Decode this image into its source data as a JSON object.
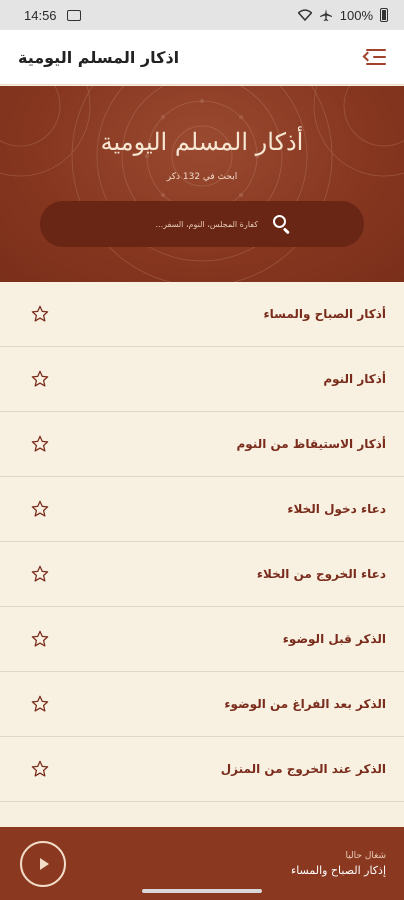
{
  "status_bar": {
    "time": "14:56",
    "battery": "100%"
  },
  "app_bar": {
    "title": "اذكار المسلم اليومية",
    "menu_icon": "menu-arrow-icon"
  },
  "hero": {
    "title": "أذكار المسلم اليومية",
    "subtitle": "ابحث في 132 ذكر",
    "search_placeholder": "كفارة المجلس، النوم، السفر...",
    "search_icon": "search-icon"
  },
  "list": {
    "items": [
      {
        "label": "أذكار الصباح والمساء"
      },
      {
        "label": "أذكار النوم"
      },
      {
        "label": "أذكار الاستيقاظ من النوم"
      },
      {
        "label": "دعاء دخول الخلاء"
      },
      {
        "label": "دعاء الخروج من الخلاء"
      },
      {
        "label": "الذكر قبل الوضوء"
      },
      {
        "label": "الذكر بعد الفراغ من الوضوء"
      },
      {
        "label": "الذكر عند الخروج من المنزل"
      }
    ],
    "star_icon": "star-outline-icon"
  },
  "now_playing": {
    "status": "شغال حاليا",
    "title": "إذكار الصباح والمساء",
    "play_icon": "play-icon"
  },
  "colors": {
    "brand": "#86361f",
    "accent_text": "#7a2c1c",
    "background": "#f8f0e1"
  }
}
